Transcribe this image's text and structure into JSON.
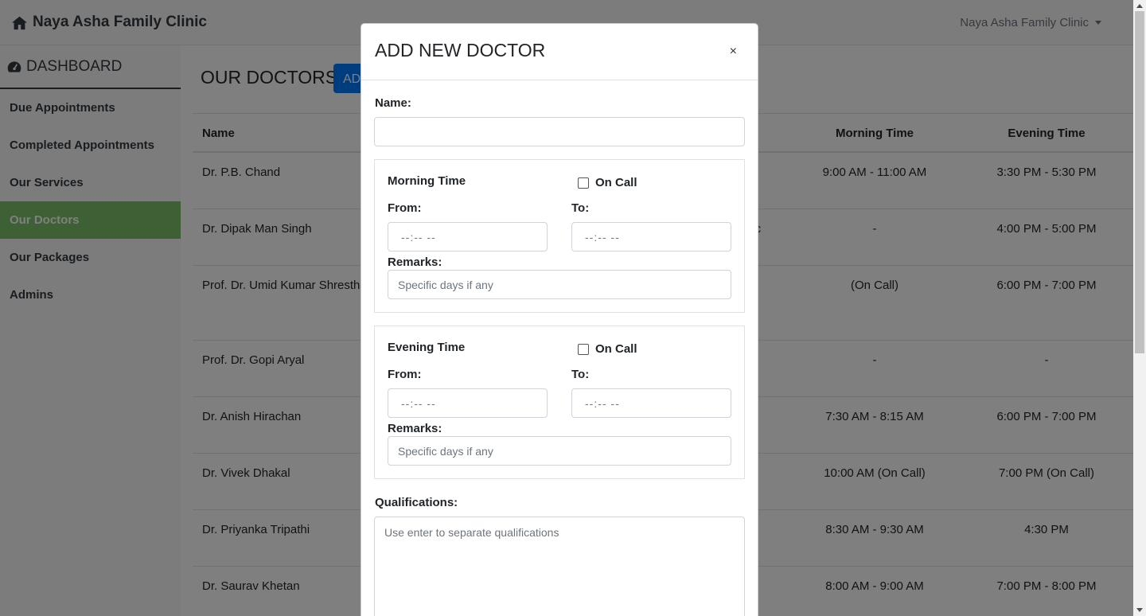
{
  "navbar": {
    "brand": "Naya Asha Family Clinic",
    "user": "Naya Asha Family Clinic"
  },
  "sidebar": {
    "title": "DASHBOARD",
    "items": [
      {
        "label": "Due Appointments",
        "active": false
      },
      {
        "label": "Completed Appointments",
        "active": false
      },
      {
        "label": "Our Services",
        "active": false
      },
      {
        "label": "Our Doctors",
        "active": true
      },
      {
        "label": "Our Packages",
        "active": false
      },
      {
        "label": "Admins",
        "active": false
      }
    ],
    "active_color": "#7ac36a"
  },
  "main": {
    "title": "OUR DOCTORS",
    "add_button": "AD",
    "table": {
      "headers": {
        "name": "Name",
        "morning": "Morning Time",
        "evening": "Evening Time"
      },
      "rows": [
        {
          "name": "Dr. P.B. Chand",
          "spec": "",
          "morning": "9:00 AM - 11:00 AM",
          "evening": "3:30 PM - 5:30 PM"
        },
        {
          "name": "Dr. Dipak Man Singh",
          "spec": "dic",
          "morning": "-",
          "evening": "4:00 PM - 5:00 PM"
        },
        {
          "name": "Prof. Dr. Umid Kumar Shrestha",
          "spec": "",
          "morning": "(On Call)",
          "evening": "6:00 PM - 7:00 PM"
        },
        {
          "name": "Prof. Dr. Gopi Aryal",
          "spec": "",
          "morning": "-",
          "evening": "-"
        },
        {
          "name": "Dr. Anish Hirachan",
          "spec": "ist",
          "morning": "7:30 AM - 8:15 AM",
          "evening": "6:00 PM - 7:00 PM"
        },
        {
          "name": "Dr. Vivek Dhakal",
          "spec": "",
          "morning": "10:00 AM (On Call)",
          "evening": "7:00 PM (On Call)"
        },
        {
          "name": "Dr. Priyanka Tripathi",
          "spec": "",
          "morning": "8:30 AM - 9:30 AM",
          "evening": "4:30 PM"
        },
        {
          "name": "Dr. Saurav Khetan",
          "spec": "",
          "morning": "8:00 AM - 9:00 AM",
          "evening": "7:00 PM - 8:00 PM"
        }
      ]
    }
  },
  "modal": {
    "title": "ADD NEW DOCTOR",
    "close": "×",
    "name_label": "Name:",
    "name_value": "",
    "morning": {
      "title": "Morning Time",
      "on_call": "On Call",
      "from_label": "From:",
      "to_label": "To:",
      "from_value": "--:-- --",
      "to_value": "--:-- --",
      "remarks_label": "Remarks:",
      "remarks_placeholder": "Specific days if any"
    },
    "evening": {
      "title": "Evening Time",
      "on_call": "On Call",
      "from_label": "From:",
      "to_label": "To:",
      "from_value": "--:-- --",
      "to_value": "--:-- --",
      "remarks_label": "Remarks:",
      "remarks_placeholder": "Specific days if any"
    },
    "qualifications_label": "Qualifications:",
    "qualifications_placeholder": "Use enter to separate qualifications"
  },
  "icons": {
    "brand": "home-icon",
    "sidebar": "dashboard-gauge-icon",
    "user": "caret-down-icon"
  },
  "colors": {
    "primary": "#007bff",
    "sidebar_active": "#7ac36a",
    "backdrop": "rgba(0,0,0,0.5)"
  }
}
